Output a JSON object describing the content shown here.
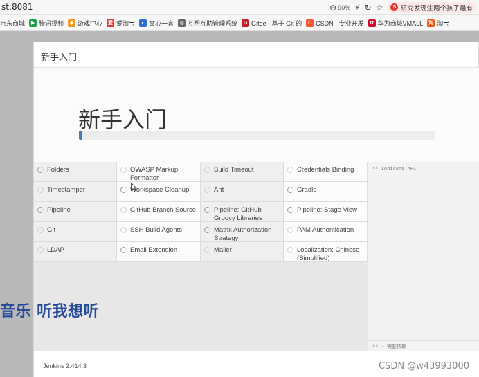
{
  "browser": {
    "url": "st:8081",
    "zoom": "90%",
    "news_text": "研究发现生两个孩子最有"
  },
  "bookmarks": [
    {
      "label": "京东商城",
      "icon": "",
      "color": ""
    },
    {
      "label": "腾讯视频",
      "icon": "▶",
      "color": "#1fa14a"
    },
    {
      "label": "游戏中心",
      "icon": "◆",
      "color": "#f29b1d"
    },
    {
      "label": "爱淘宝",
      "icon": "爱",
      "color": "#e53935"
    },
    {
      "label": "文心一言",
      "icon": "◐",
      "color": "#2f6fd6"
    },
    {
      "label": "互帮互助管理系统",
      "icon": "◍",
      "color": "#666666"
    },
    {
      "label": "Gitee - 基于 Git 的",
      "icon": "G",
      "color": "#c71d23"
    },
    {
      "label": "CSDN - 专业开发",
      "icon": "C",
      "color": "#fc5531"
    },
    {
      "label": "华为商城VMALL",
      "icon": "✿",
      "color": "#cf0a2c"
    },
    {
      "label": "淘宝",
      "icon": "淘",
      "color": "#ff5000"
    }
  ],
  "dialog": {
    "header_title": "新手入门",
    "hero_title": "新手入门",
    "progress_fraction": 0.01,
    "plugins": [
      {
        "label": "Folders",
        "state": "installing"
      },
      {
        "label": "OWASP Markup Formatter",
        "state": "pending"
      },
      {
        "label": "Build Timeout",
        "state": "pending"
      },
      {
        "label": "Credentials Binding",
        "state": "pending"
      },
      {
        "label": "Timestamper",
        "state": "pending"
      },
      {
        "label": "Workspace Cleanup",
        "state": "installing"
      },
      {
        "label": "Ant",
        "state": "pending"
      },
      {
        "label": "Gradle",
        "state": "installing"
      },
      {
        "label": "Pipeline",
        "state": "installing"
      },
      {
        "label": "GitHub Branch Source",
        "state": "pending"
      },
      {
        "label": "Pipeline: GitHub Groovy Libraries",
        "state": "installing"
      },
      {
        "label": "Pipeline: Stage View",
        "state": "installing"
      },
      {
        "label": "Git",
        "state": "pending"
      },
      {
        "label": "SSH Build Agents",
        "state": "pending"
      },
      {
        "label": "Matrix Authorization Strategy",
        "state": "installing"
      },
      {
        "label": "PAM Authentication",
        "state": "pending"
      },
      {
        "label": "LDAP",
        "state": "pending"
      },
      {
        "label": "Email Extension",
        "state": "installing"
      },
      {
        "label": "Mailer",
        "state": "pending"
      },
      {
        "label": "Localization: Chinese (Simplified)",
        "state": "pending"
      }
    ],
    "log_top": "** Ionicons API",
    "log_bottom": "** - 需要依赖",
    "version": "Jenkins 2.414.3"
  },
  "overlay_text": "音乐 听我想听",
  "watermark": "CSDN @w43993000",
  "colors": {
    "progress": "#4a7bb7",
    "overlay": "#274b9b"
  }
}
